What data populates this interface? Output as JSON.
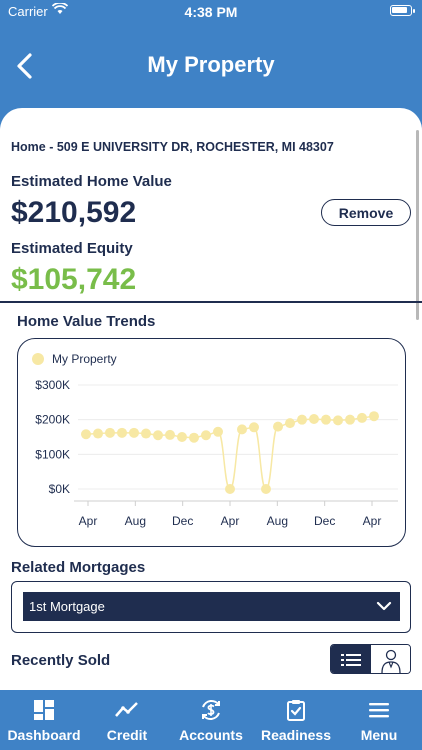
{
  "status_bar": {
    "carrier": "Carrier",
    "time": "4:38 PM"
  },
  "header": {
    "title": "My Property"
  },
  "property": {
    "address": "Home - 509 E UNIVERSITY DR, ROCHESTER, MI 48307",
    "estimated_home_value_label": "Estimated Home Value",
    "estimated_home_value": "$210,592",
    "remove_label": "Remove",
    "estimated_equity_label": "Estimated Equity",
    "estimated_equity": "$105,742"
  },
  "trends": {
    "title": "Home Value Trends"
  },
  "chart_data": {
    "type": "line",
    "legend": "My Property",
    "y_ticks": [
      "$300K",
      "$200K",
      "$100K",
      "$0K"
    ],
    "y_tick_values": [
      300000,
      200000,
      100000,
      0
    ],
    "x_ticks": [
      "Apr",
      "Aug",
      "Dec",
      "Apr",
      "Aug",
      "Dec",
      "Apr"
    ],
    "ylim": [
      0,
      300000
    ],
    "series_color": "#f7e8a4",
    "values": [
      158000,
      160000,
      162000,
      162000,
      162000,
      160000,
      155000,
      156000,
      150000,
      148000,
      155000,
      165000,
      0,
      172000,
      178000,
      0,
      180000,
      190000,
      200000,
      202000,
      200000,
      198000,
      200000,
      205000,
      210000
    ]
  },
  "mortgages": {
    "title": "Related Mortgages",
    "selected": "1st Mortgage"
  },
  "recently_sold": {
    "title": "Recently Sold"
  },
  "tabs": [
    {
      "label": "Dashboard",
      "icon": "dashboard-icon"
    },
    {
      "label": "Credit",
      "icon": "credit-trend-icon"
    },
    {
      "label": "Accounts",
      "icon": "accounts-dollar-icon"
    },
    {
      "label": "Readiness",
      "icon": "readiness-clipboard-icon"
    },
    {
      "label": "Menu",
      "icon": "hamburger-menu-icon"
    }
  ],
  "colors": {
    "brand_blue": "#3f82c6",
    "navy": "#1f2d4f",
    "equity_green": "#79bd4a",
    "chart_yellow": "#f7e8a4"
  }
}
